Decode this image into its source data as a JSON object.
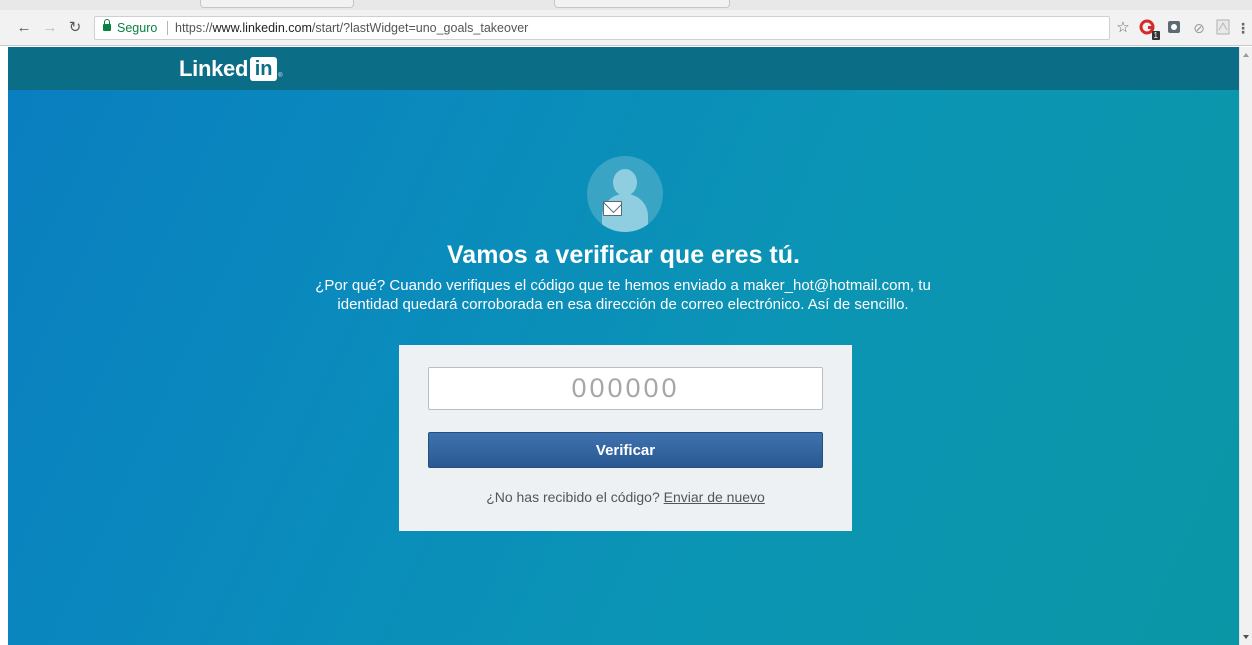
{
  "browser": {
    "secure_label": "Seguro",
    "url_scheme": "https://",
    "url_host": "www.linkedin.com",
    "url_path": "/start/?lastWidget=uno_goals_takeover",
    "extension_badge": "1"
  },
  "header": {
    "logo_word": "Linked",
    "logo_box": "in",
    "logo_reg": "®"
  },
  "main": {
    "title": "Vamos a verificar que eres tú.",
    "description_line1": "¿Por qué? Cuando verifiques el código que te hemos enviado a maker_hot@hotmail.com, tu",
    "description_line2": "identidad quedará corroborada en esa dirección de correo electrónico. Así de sencillo."
  },
  "form": {
    "code_placeholder": "000000",
    "verify_label": "Verificar",
    "resend_prompt": "¿No has recibido el código?",
    "resend_link": "Enviar de nuevo"
  },
  "colors": {
    "brand_blue": "#0b6d86",
    "button_blue": "#2f62a0",
    "secure_green": "#0b8043"
  }
}
